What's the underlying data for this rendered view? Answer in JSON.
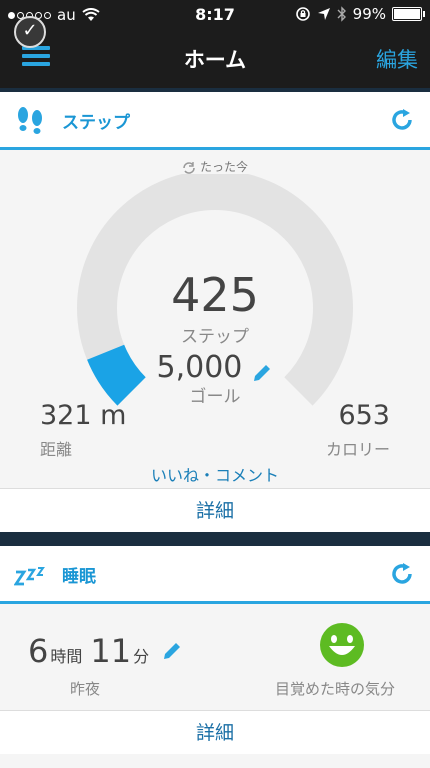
{
  "status": {
    "carrier": "au",
    "time": "8:17",
    "battery": "99%"
  },
  "nav": {
    "title": "ホーム",
    "edit_label": "編集"
  },
  "steps": {
    "title": "ステップ",
    "updated": "たった今",
    "count": "425",
    "count_label": "ステップ",
    "goal": "5,000",
    "goal_label": "ゴール",
    "progress": 0.085,
    "distance": "321 m",
    "distance_label": "距離",
    "calories": "653",
    "calories_label": "カロリー",
    "like_label": "いいね・コメント",
    "detail_label": "詳細"
  },
  "sleep": {
    "title": "睡眠",
    "hours": "6",
    "hours_unit": "時間",
    "minutes": "11",
    "minutes_unit": "分",
    "night_label": "昨夜",
    "mood_label": "目覚めた時の気分",
    "detail_label": "詳細"
  },
  "colors": {
    "accent": "#2aa5e0",
    "mood": "#5dbb22"
  }
}
